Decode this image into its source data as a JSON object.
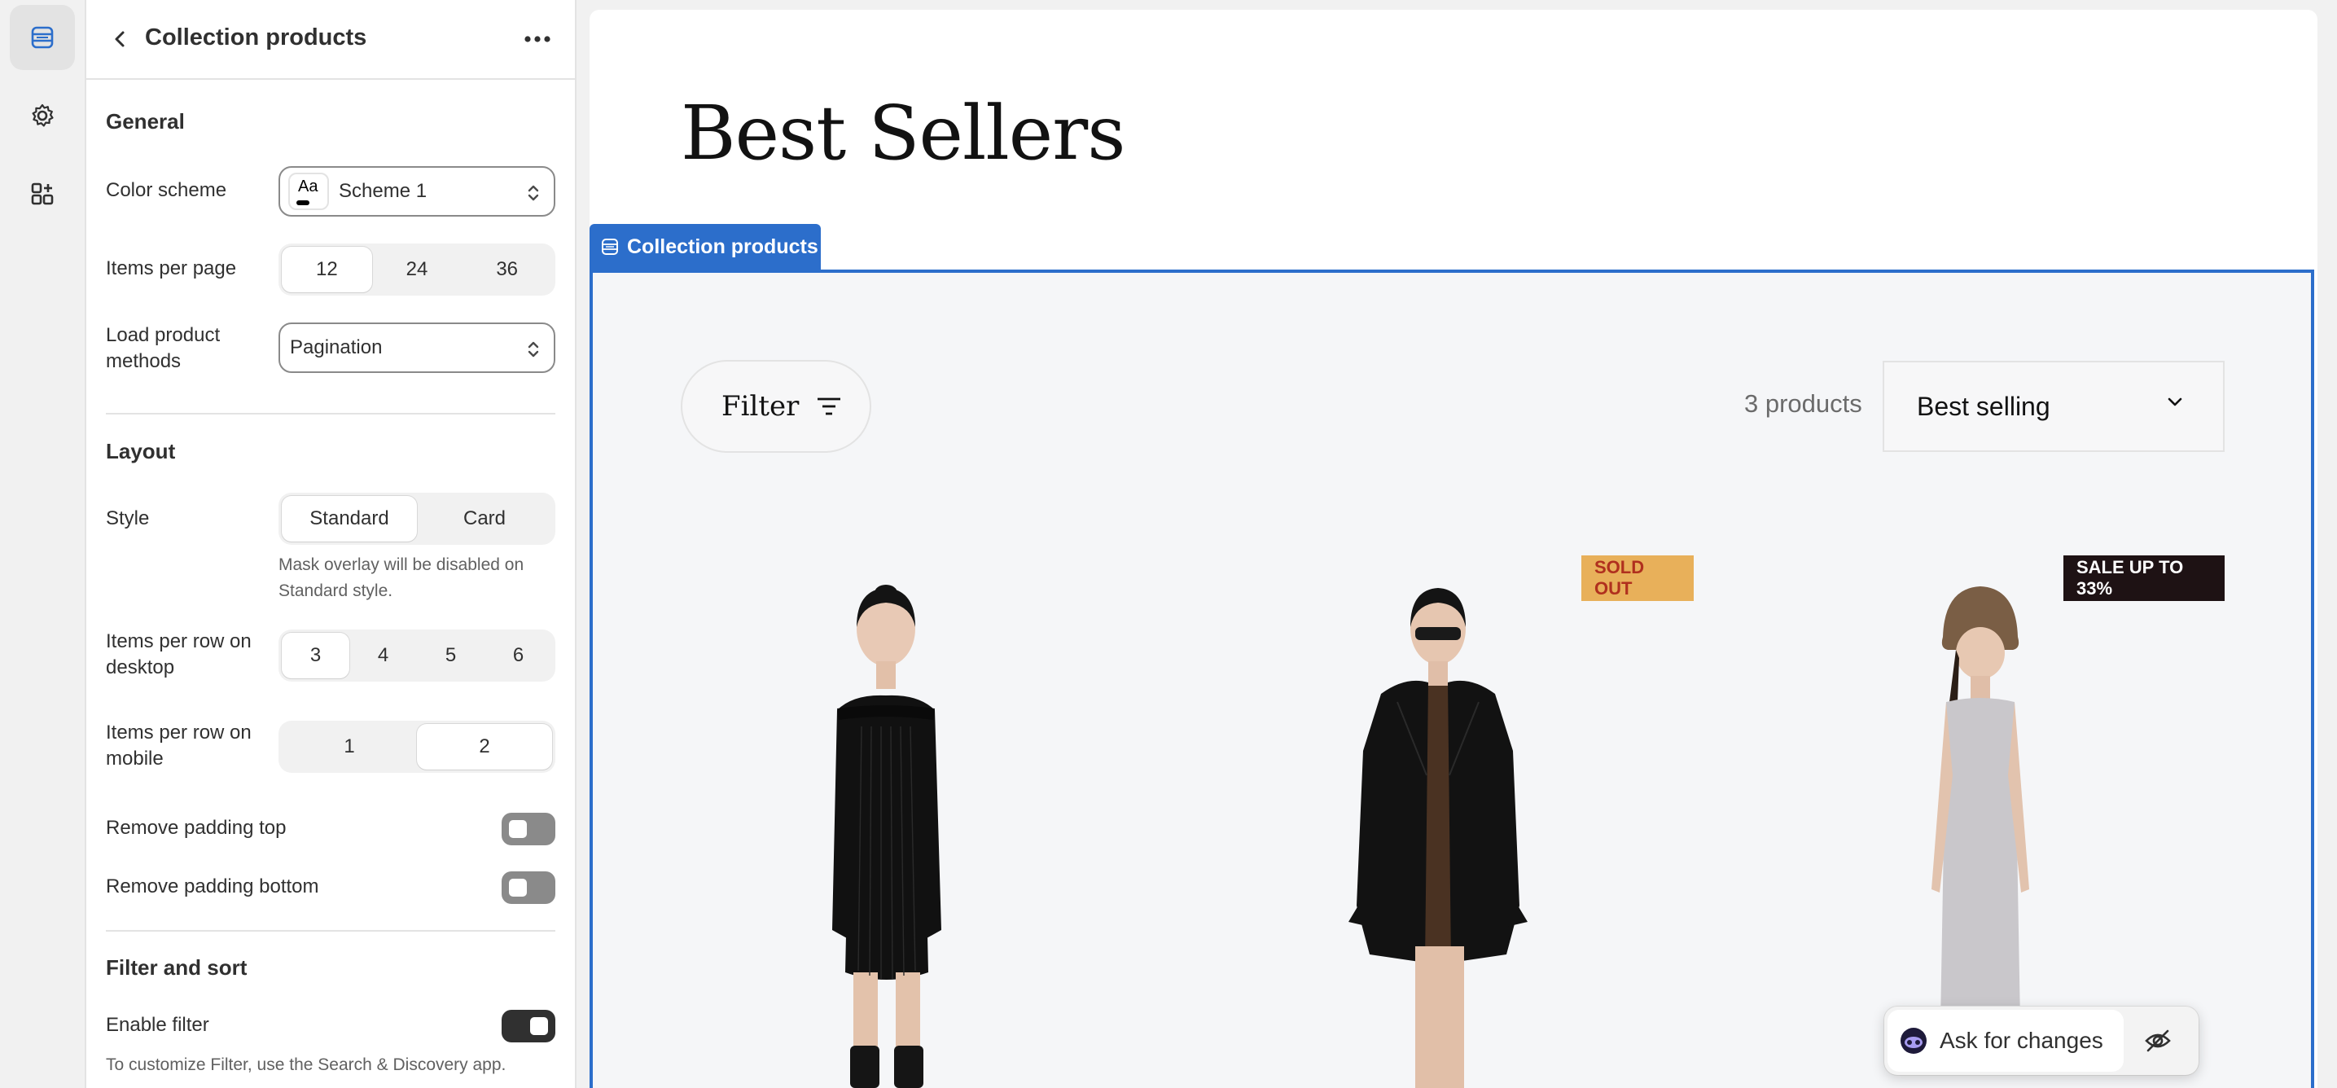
{
  "rail": {
    "items": [
      "sections-icon",
      "settings-gear-icon",
      "apps-icon"
    ]
  },
  "panel": {
    "title": "Collection products",
    "general": {
      "heading": "General",
      "color_scheme_label": "Color scheme",
      "color_scheme_swatch": "Aa",
      "color_scheme_value": "Scheme 1",
      "items_per_page_label": "Items per page",
      "items_per_page_options": [
        "12",
        "24",
        "36"
      ],
      "items_per_page_selected": "12",
      "load_methods_label": "Load product methods",
      "load_methods_value": "Pagination"
    },
    "layout": {
      "heading": "Layout",
      "style_label": "Style",
      "style_options": [
        "Standard",
        "Card"
      ],
      "style_selected": "Standard",
      "style_help": "Mask overlay will be disabled on Standard style.",
      "desktop_label": "Items per row on desktop",
      "desktop_options": [
        "3",
        "4",
        "5",
        "6"
      ],
      "desktop_selected": "3",
      "mobile_label": "Items per row on mobile",
      "mobile_options": [
        "1",
        "2"
      ],
      "mobile_selected": "2",
      "padding_top_label": "Remove padding top",
      "padding_top_on": false,
      "padding_bottom_label": "Remove padding bottom",
      "padding_bottom_on": false
    },
    "filter_sort": {
      "heading": "Filter and sort",
      "enable_filter_label": "Enable filter",
      "enable_filter_on": true,
      "help": "To customize Filter, use the Search & Discovery app."
    }
  },
  "preview": {
    "heading": "Best Sellers",
    "section_tag": "Collection products",
    "filter_label": "Filter",
    "product_count": "3 products",
    "sort_value": "Best selling",
    "badges": {
      "sold_out": "SOLD OUT",
      "sale": "SALE UP TO 33%"
    },
    "ask_label": "Ask for changes"
  },
  "colors": {
    "accent": "#2c6ecb",
    "sold_badge": "#e8b05a",
    "sale_badge": "#1e1214"
  }
}
